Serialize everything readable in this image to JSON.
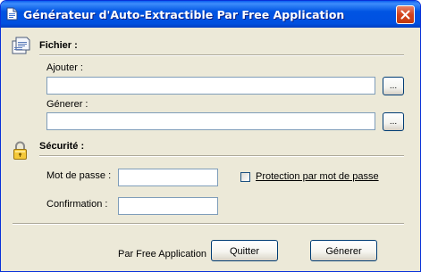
{
  "window": {
    "title": "Générateur d'Auto-Extractible Par Free Application"
  },
  "fichier": {
    "title": "Fichier :",
    "icon": "document-icon",
    "ajouter_label": "Ajouter :",
    "ajouter_value": "",
    "browse_label": "...",
    "generer_label": "Génerer :",
    "generer_value": ""
  },
  "securite": {
    "title": "Sécurité :",
    "icon": "padlock-icon",
    "password_label": "Mot de passe :",
    "password_value": "",
    "confirmation_label": "Confirmation :",
    "confirmation_value": "",
    "protection_label": "Protection par mot de passe",
    "protection_checked": false
  },
  "footer": {
    "credit": "Par Free Application",
    "quit_label": "Quitter",
    "generate_label": "Génerer"
  },
  "colors": {
    "titlebar": "#0054e3",
    "window_bg": "#ece9d8",
    "close_button": "#d3421c",
    "input_border": "#7f9db9"
  }
}
